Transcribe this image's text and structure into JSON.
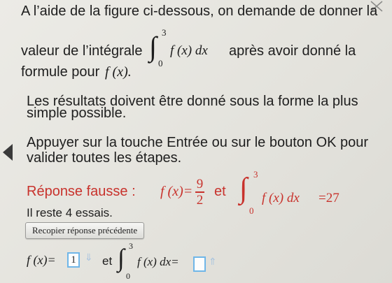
{
  "question": {
    "line1": "A l’aide de la figure ci-dessous, on demande de donner la",
    "line2_before": "valeur de l’intégrale",
    "integral_upper": "3",
    "integral_lower": "0",
    "integral_body": "f (x) dx",
    "line2_after": "après avoir donné la",
    "line3_before": "formule pour",
    "line3_math": "f (x).",
    "instruction1_line1": "Les résultats doivent être donné sous la forme la plus",
    "instruction1_line2": "simple possible.",
    "instruction2_line1": "Appuyer sur la touche Entrée ou sur le bouton OK pour",
    "instruction2_line2": "valider toutes les étapes."
  },
  "feedback": {
    "label": "Réponse fausse :",
    "fx": "f (x)=",
    "numerator": "9",
    "denominator": "2",
    "et": "et",
    "integral_upper": "3",
    "integral_lower": "0",
    "integral_body": "f (x) dx",
    "integral_result": "=27",
    "attempts": "Il reste 4 essais."
  },
  "controls": {
    "copy_button": "Recopier réponse précédente",
    "fx_label": "f (x)=",
    "fx_value": "1",
    "et": "et",
    "integral_upper": "3",
    "integral_lower": "0",
    "integral_body": "f (x) dx=",
    "integral_value": ""
  },
  "icons": {
    "left_arrow": "arrow-left-icon",
    "down_hint": "arrow-down-icon",
    "up_hint": "arrow-up-icon",
    "close": "close-icon"
  },
  "colors": {
    "error": "#c8322c",
    "input_border": "#6fb6e8"
  }
}
